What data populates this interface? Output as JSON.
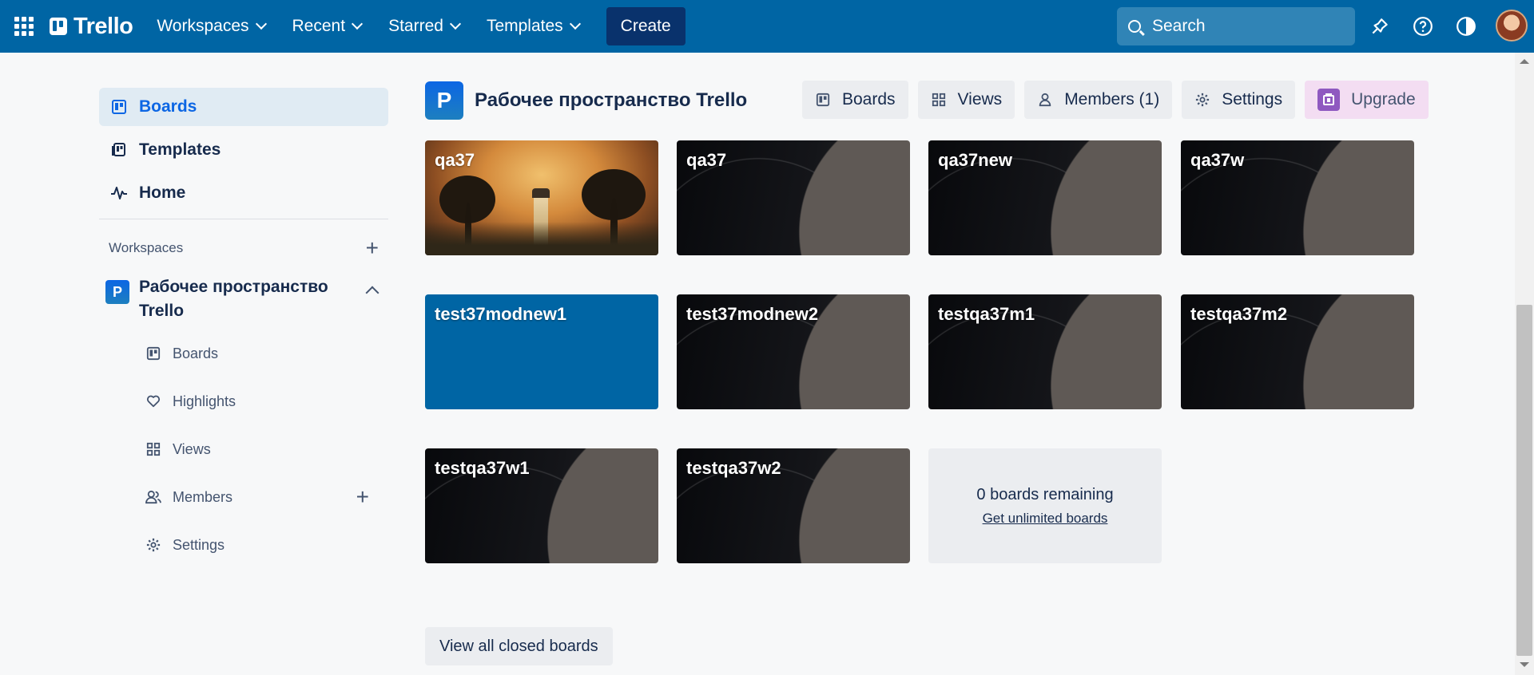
{
  "topbar": {
    "brand": "Trello",
    "nav": [
      {
        "label": "Workspaces"
      },
      {
        "label": "Recent"
      },
      {
        "label": "Starred"
      },
      {
        "label": "Templates"
      }
    ],
    "create_label": "Create",
    "search_placeholder": "Search"
  },
  "sidebar": {
    "nav": [
      {
        "label": "Boards",
        "icon": "board-icon",
        "active": true
      },
      {
        "label": "Templates",
        "icon": "template-icon"
      },
      {
        "label": "Home",
        "icon": "activity-icon"
      }
    ],
    "workspaces_heading": "Workspaces",
    "workspace": {
      "badge": "P",
      "name": "Рабочее пространство Trello",
      "items": [
        {
          "label": "Boards",
          "icon": "board-icon"
        },
        {
          "label": "Highlights",
          "icon": "heart-icon"
        },
        {
          "label": "Views",
          "icon": "grid-icon"
        },
        {
          "label": "Members",
          "icon": "members-icon"
        },
        {
          "label": "Settings",
          "icon": "gear-icon"
        }
      ]
    }
  },
  "main": {
    "workspace_badge": "P",
    "workspace_title": "Рабочее пространство Trello",
    "tabs": [
      {
        "label": "Boards",
        "icon": "board-icon"
      },
      {
        "label": "Views",
        "icon": "grid-icon"
      },
      {
        "label": "Members (1)",
        "icon": "person-icon"
      },
      {
        "label": "Settings",
        "icon": "gear-icon"
      },
      {
        "label": "Upgrade",
        "icon": "upgrade-icon"
      }
    ],
    "boards": [
      {
        "title": "qa37",
        "bg": "photo"
      },
      {
        "title": "qa37",
        "bg": "dark"
      },
      {
        "title": "qa37new",
        "bg": "dark"
      },
      {
        "title": "qa37w",
        "bg": "dark"
      },
      {
        "title": "test37modnew1",
        "bg": "blue"
      },
      {
        "title": "test37modnew2",
        "bg": "dark"
      },
      {
        "title": "testqa37m1",
        "bg": "dark"
      },
      {
        "title": "testqa37m2",
        "bg": "dark"
      },
      {
        "title": "testqa37w1",
        "bg": "dark"
      },
      {
        "title": "testqa37w2",
        "bg": "dark"
      }
    ],
    "remaining": {
      "count_text": "0 boards remaining",
      "link_text": "Get unlimited boards"
    },
    "closed_boards_label": "View all closed boards"
  },
  "colors": {
    "header": "#0065a4",
    "create": "#09326c",
    "active_nav": "#e0ebf3",
    "blue_board": "#0065a4",
    "upgrade_bg": "#f3ddf2",
    "upgrade_icon": "#8f59c0"
  }
}
